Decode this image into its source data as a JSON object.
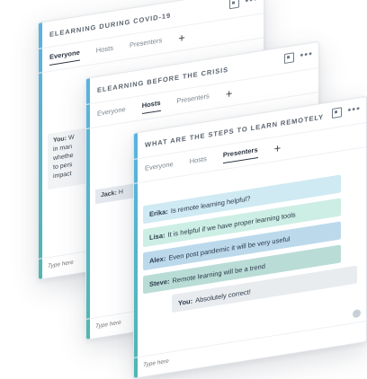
{
  "panels": [
    {
      "title": "ELEARNING DURING COVID-19",
      "tabs": [
        "Everyone",
        "Hosts",
        "Presenters"
      ],
      "active_tab": "Everyone",
      "peek_message": {
        "author": "You:",
        "lines": [
          "W",
          "in man",
          "whethe",
          "to pers",
          "impact"
        ]
      },
      "input_placeholder": "Type here"
    },
    {
      "title": "ELEARNING BEFORE THE CRISIS",
      "tabs": [
        "Everyone",
        "Hosts",
        "Presenters"
      ],
      "active_tab": "Hosts",
      "peek_message": {
        "author": "Jack:",
        "text": "H"
      },
      "input_placeholder": "Type here"
    },
    {
      "title": "WHAT ARE THE STEPS TO LEARN REMOTELY",
      "tabs": [
        "Everyone",
        "Hosts",
        "Presenters"
      ],
      "active_tab": "Presenters",
      "messages": [
        {
          "author": "Erika:",
          "text": "Is remote learning helpful?"
        },
        {
          "author": "Lisa:",
          "text": "It is helpful if we have proper learning tools"
        },
        {
          "author": "Alex:",
          "text": "Even post pandemic it will be very useful"
        },
        {
          "author": "Steve:",
          "text": "Remote learning will be a trend"
        },
        {
          "author": "You:",
          "text": "Absolutely correct!"
        }
      ],
      "input_placeholder": "Type here"
    }
  ],
  "add_tab_label": "+",
  "more_label": "•••",
  "icons": [
    "expand-icon",
    "more-icon",
    "add-tab-icon"
  ],
  "colors": {
    "accent_top": "#5ab3e0",
    "accent_bottom": "#4fb7b0"
  }
}
